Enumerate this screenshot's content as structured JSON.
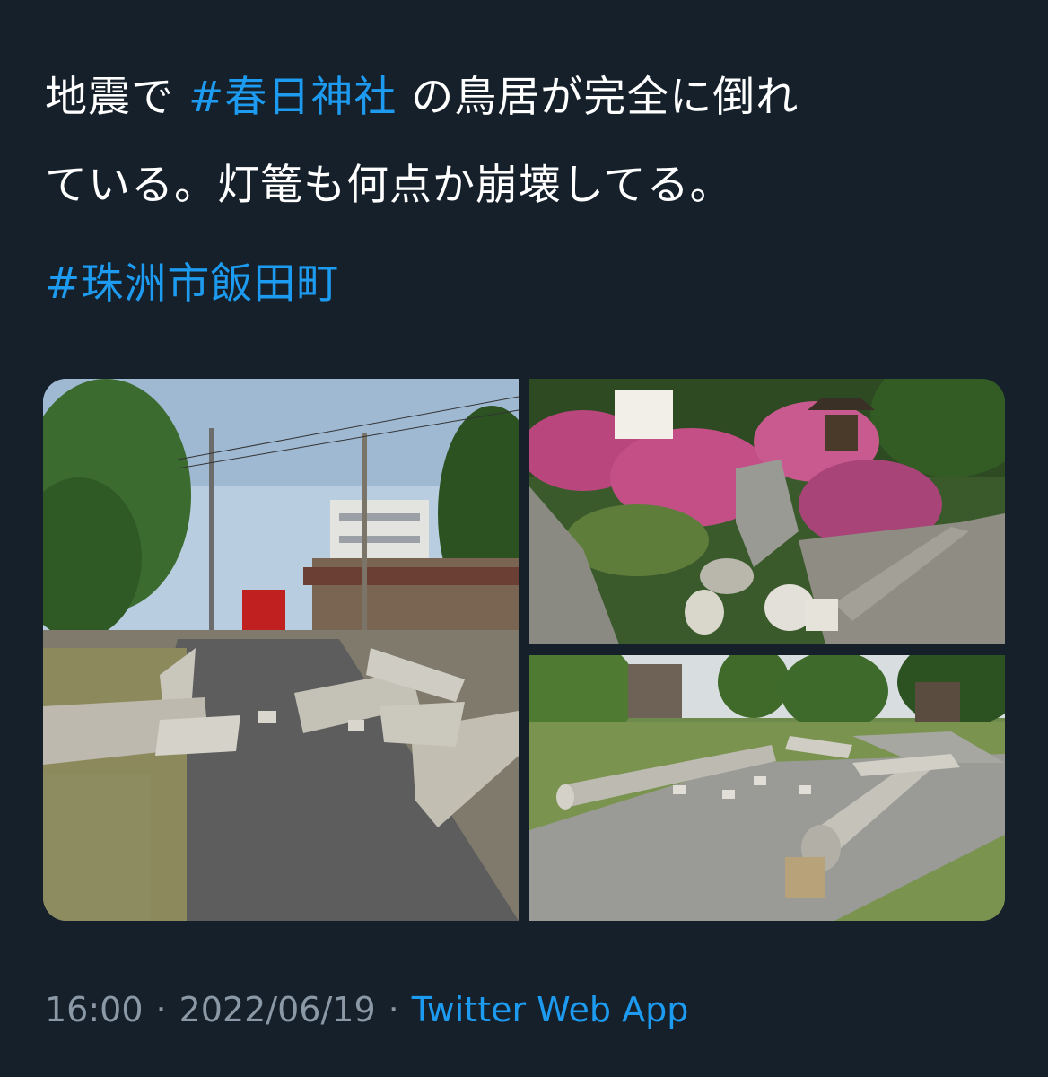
{
  "tweet": {
    "text_line1_pre": "地震で ",
    "hashtag_1": "#春日神社",
    "text_line1_post": " の鳥居が完全に倒れ",
    "text_line2": "ている。灯篭も何点か崩壊してる。",
    "hashtag_2": "#珠洲市飯田町"
  },
  "media": {
    "photos": [
      {
        "label": "photo-1"
      },
      {
        "label": "photo-2"
      },
      {
        "label": "photo-3"
      }
    ]
  },
  "meta": {
    "time": "16:00",
    "separator": "·",
    "date": "2022/06/19",
    "source": "Twitter Web App"
  },
  "colors": {
    "background": "#15202b",
    "link": "#1d9bf0",
    "secondary_text": "#8b98a5"
  }
}
